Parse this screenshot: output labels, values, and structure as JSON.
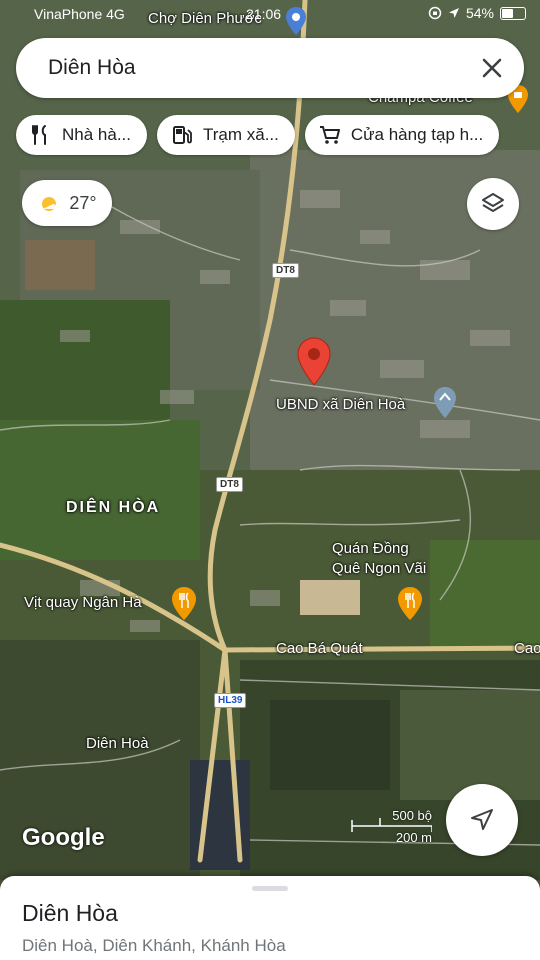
{
  "status_bar": {
    "carrier": "VinaPhone 4G",
    "time": "21:06",
    "battery": "54%",
    "battery_level": 0.54
  },
  "search": {
    "query": "Diên Hòa"
  },
  "chips": [
    {
      "label": "Nhà hà...",
      "icon": "restaurant-icon"
    },
    {
      "label": "Trạm xă...",
      "icon": "gas-station-icon"
    },
    {
      "label": "Cửa hàng tạp h...",
      "icon": "shopping-cart-icon"
    }
  ],
  "weather": {
    "temp": "27°",
    "icon": "sun-icon"
  },
  "map": {
    "poi_labels": {
      "cho_dien_phuoc": "Chợ Diên Phước",
      "champa_coffee": "Champa Coffee",
      "ubnd": "UBND xã Diên Hoà",
      "quan_dong_que_1": "Quán Đồng",
      "quan_dong_que_2": "Quê Ngon Vãi",
      "vit_quay": "Vịt quay Ngân Hà",
      "area_name": "DIÊN HÒA",
      "area_small": "Diên Hoà"
    },
    "road_labels": {
      "dt8_top": "DT8",
      "dt8_mid": "DT8",
      "hl39": "HL39",
      "cao_ba_quat": "Cao Bá Quát",
      "cao_right": "Cao"
    },
    "branding": "Google",
    "scale": {
      "imperial": "500 bộ",
      "metric": "200 m"
    },
    "colors": {
      "pin_red": "#ea4335",
      "food_pin": "#f29900",
      "poi_gray": "#7e9cb3"
    }
  },
  "sheet": {
    "title": "Diên Hòa",
    "subtitle": "Diên Hoà, Diên Khánh, Khánh Hòa"
  }
}
